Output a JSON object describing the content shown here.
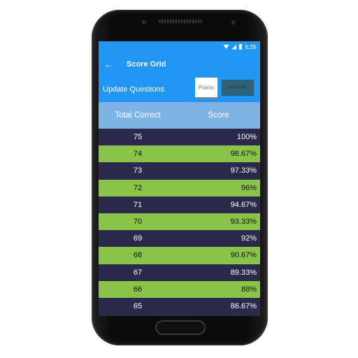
{
  "status_bar": {
    "time": "6:29"
  },
  "app_bar": {
    "back_icon": "arrow-left-icon",
    "title": "Score Grid"
  },
  "update": {
    "label": "Update Questions",
    "points_placeholder": "Points",
    "button_label": "UPDATE"
  },
  "table": {
    "headers": [
      "Total Correct",
      "Score"
    ],
    "rows": [
      [
        "75",
        "100%"
      ],
      [
        "74",
        "98.67%"
      ],
      [
        "73",
        "97.33%"
      ],
      [
        "72",
        "96%"
      ],
      [
        "71",
        "94.67%"
      ],
      [
        "70",
        "93.33%"
      ],
      [
        "69",
        "92%"
      ],
      [
        "68",
        "90.67%"
      ],
      [
        "67",
        "89.33%"
      ],
      [
        "66",
        "88%"
      ],
      [
        "65",
        "86.67%"
      ]
    ]
  },
  "colors": {
    "primary": "#2196f3",
    "header": "#7fb3e6",
    "row_dark": "#2a2a4a",
    "row_light": "#8bc34a"
  }
}
